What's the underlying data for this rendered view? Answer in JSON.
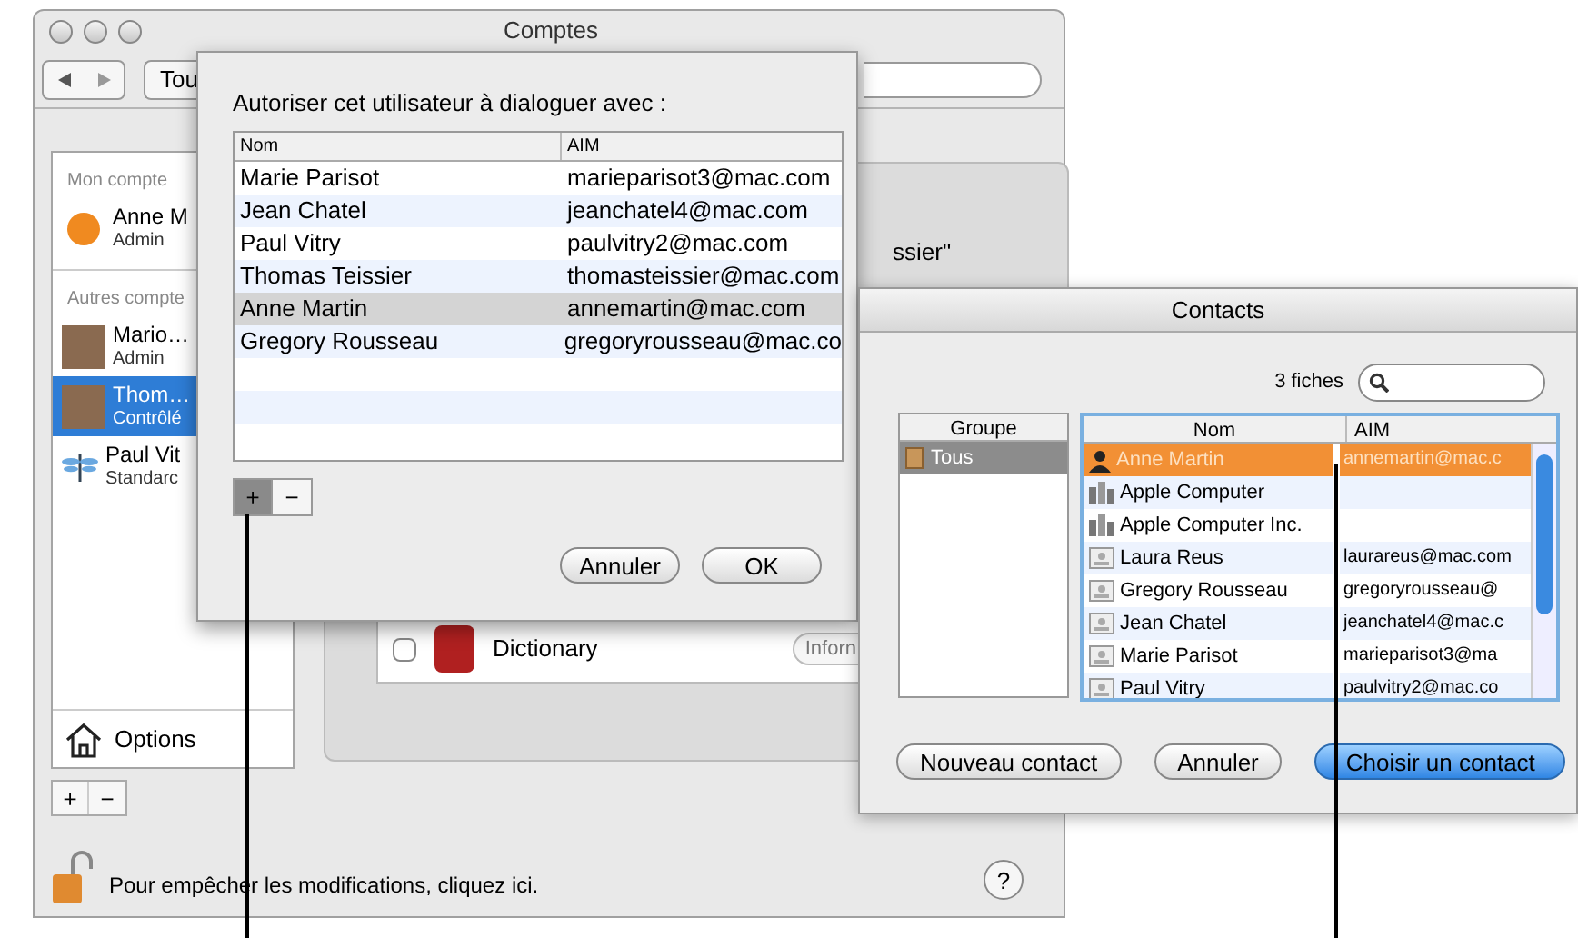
{
  "window": {
    "title": "Comptes",
    "show_all_button": "Tou"
  },
  "accounts": {
    "sections": [
      {
        "header": "Mon compte",
        "items": [
          {
            "name": "Anne M",
            "role": "Admin",
            "kind": "ball",
            "selected": false
          }
        ]
      },
      {
        "header": "Autres compte",
        "items": [
          {
            "name": "Mario…",
            "role": "Admin",
            "kind": "photo",
            "selected": false
          },
          {
            "name": "Thom…",
            "role": "Contrôlé",
            "kind": "photo",
            "selected": true
          },
          {
            "name": "Paul Vit",
            "role": "Standarc",
            "kind": "dragonfly",
            "selected": false
          }
        ]
      }
    ],
    "options": "Options"
  },
  "panel": {
    "quote_fragment": "ssier\"",
    "apps": [
      {
        "name": "Dictionary",
        "checked": false,
        "button": "Inforn"
      }
    ]
  },
  "lock_text": "Pour empêcher les modifications, cliquez ici.",
  "help_button": "?",
  "sheet": {
    "prompt": "Autoriser cet utilisateur à dialoguer avec :",
    "columns": [
      "Nom",
      "AIM"
    ],
    "rows": [
      {
        "name": "Marie Parisot",
        "aim": "marieparisot3@mac.com",
        "selected": false
      },
      {
        "name": "Jean Chatel",
        "aim": "jeanchatel4@mac.com",
        "selected": false
      },
      {
        "name": "Paul Vitry",
        "aim": "paulvitry2@mac.com",
        "selected": false
      },
      {
        "name": "Thomas Teissier",
        "aim": "thomasteissier@mac.com",
        "selected": false
      },
      {
        "name": "Anne Martin",
        "aim": "annemartin@mac.com",
        "selected": true
      },
      {
        "name": "Gregory Rousseau",
        "aim": "gregoryrousseau@mac.co",
        "selected": false
      }
    ],
    "add_button": {
      "label": "+",
      "pressed": true
    },
    "remove_button": "−",
    "buttons": [
      "Annuler",
      "OK"
    ]
  },
  "contacts": {
    "title": "Contacts",
    "count": "3 fiches",
    "group_column": "Groupe",
    "groups": [
      {
        "name": "Tous",
        "selected": true
      }
    ],
    "columns": [
      "Nom",
      "AIM"
    ],
    "rows": [
      {
        "kind": "person",
        "name": "Anne Martin",
        "aim": "annemartin@mac.c",
        "selected": true
      },
      {
        "kind": "company",
        "name": "Apple Computer",
        "selected": false
      },
      {
        "kind": "company",
        "name": "Apple Computer Inc.",
        "selected": false
      },
      {
        "kind": "card",
        "name": "Laura Reus",
        "aim": "laurareus@mac.com",
        "selected": false
      },
      {
        "kind": "card",
        "name": "Gregory Rousseau",
        "aim": "gregoryrousseau@",
        "selected": false
      },
      {
        "kind": "card",
        "name": "Jean Chatel",
        "aim": "jeanchatel4@mac.c",
        "selected": false
      },
      {
        "kind": "card",
        "name": "Marie Parisot",
        "aim": "marieparisot3@ma",
        "selected": false
      },
      {
        "kind": "card",
        "name": "Paul Vitry",
        "aim": "paulvitry2@mac.co",
        "selected": false
      }
    ],
    "buttons": [
      {
        "label": "Nouveau contact",
        "default": false
      },
      {
        "label": "Annuler",
        "default": false
      },
      {
        "label": "Choisir un contact",
        "default": true
      }
    ]
  }
}
